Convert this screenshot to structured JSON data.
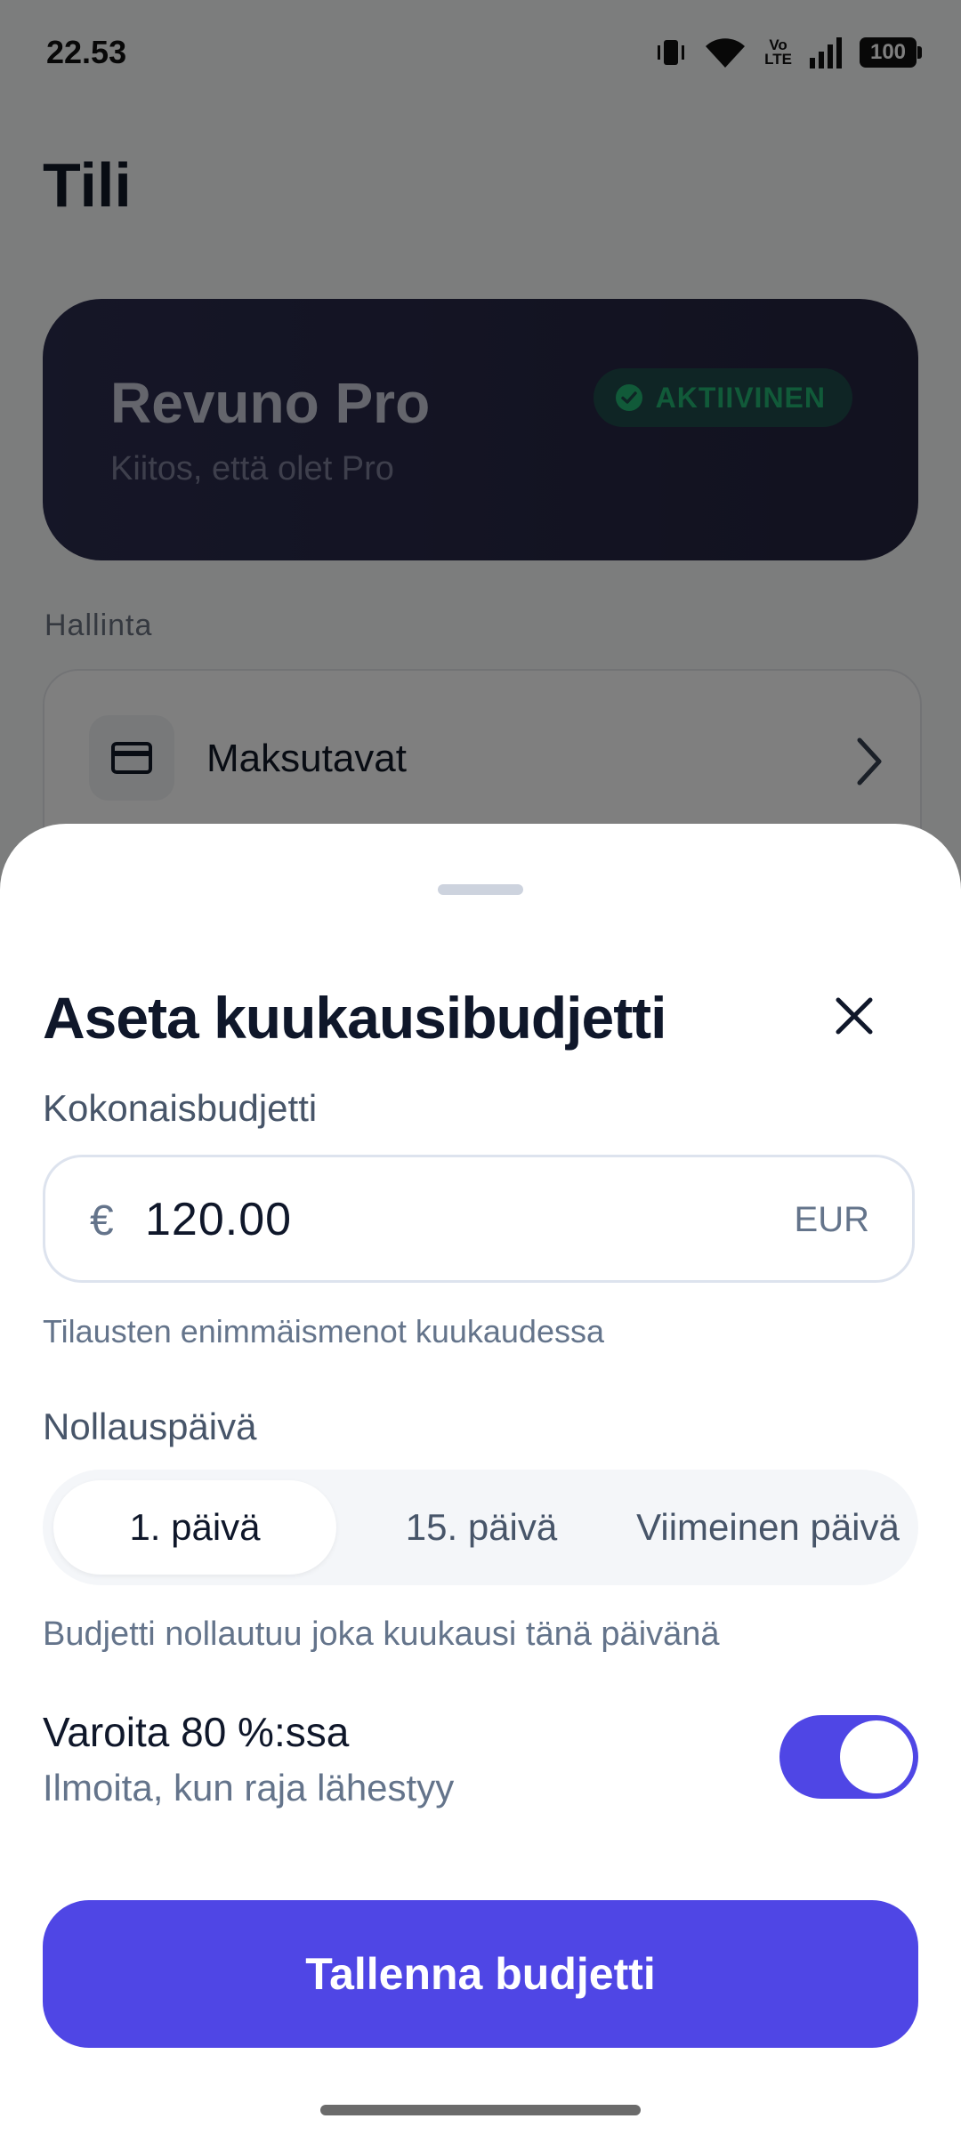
{
  "status_bar": {
    "time": "22.53",
    "battery": "100",
    "network_label": "Vo\nLTE"
  },
  "background": {
    "title": "Tili",
    "pro_card": {
      "title": "Revuno Pro",
      "subtitle": "Kiitos, että olet Pro",
      "badge": "AKTIIVINEN"
    },
    "section_label": "Hallinta",
    "menu_items": [
      {
        "label": "Maksutavat",
        "icon": "credit-card-icon"
      }
    ]
  },
  "sheet": {
    "title": "Aseta kuukausibudjetti",
    "total_label": "Kokonaisbudjetti",
    "amount": {
      "symbol": "€",
      "value": "120.00",
      "currency": "EUR"
    },
    "total_helper": "Tilausten enimmäismenot kuukaudessa",
    "reset_label": "Nollauspäivä",
    "reset_options": [
      "1. päivä",
      "15. päivä",
      "Viimeinen päivä"
    ],
    "reset_selected": "1. päivä",
    "reset_helper": "Budjetti nollautuu joka kuukausi tänä päivänä",
    "alert": {
      "title": "Varoita 80 %:ssa",
      "subtitle": "Ilmoita, kun raja lähestyy",
      "enabled": true
    },
    "save_label": "Tallenna budjetti"
  },
  "colors": {
    "accent": "#4f46e5",
    "card_dark": "#2b2c4e",
    "badge_green": "#22b573"
  }
}
